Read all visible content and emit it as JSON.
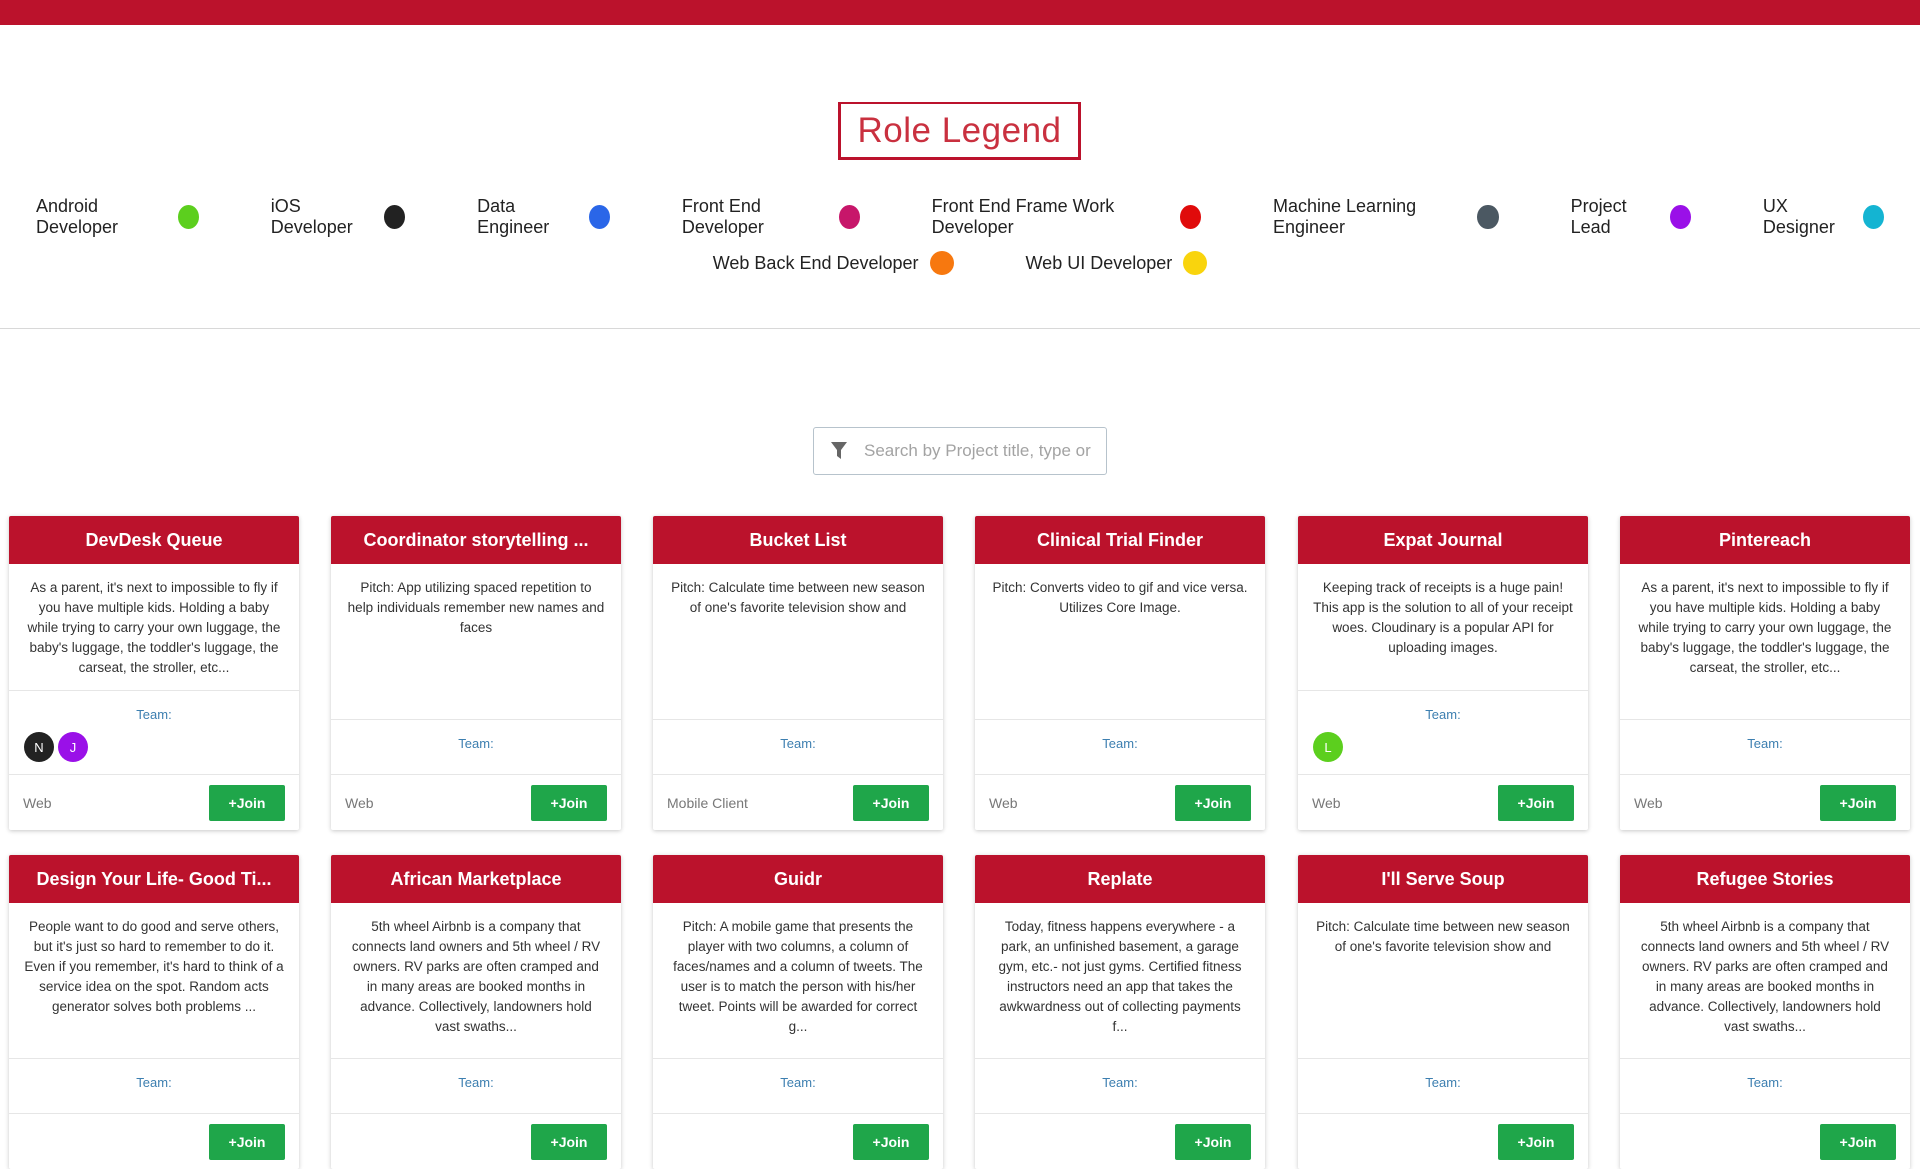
{
  "legend": {
    "title": "Role Legend",
    "roles": [
      {
        "name": "Android Developer",
        "color": "#5ccf1e"
      },
      {
        "name": "iOS Developer",
        "color": "#222222"
      },
      {
        "name": "Data Engineer",
        "color": "#2a66e8"
      },
      {
        "name": "Front End Developer",
        "color": "#c7166a"
      },
      {
        "name": "Front End Frame Work Developer",
        "color": "#e00b0b"
      },
      {
        "name": "Machine Learning Engineer",
        "color": "#4b5862"
      },
      {
        "name": "Project Lead",
        "color": "#9a10e8"
      },
      {
        "name": "UX Designer",
        "color": "#14b4d2"
      },
      {
        "name": "Web Back End Developer",
        "color": "#f7780f"
      },
      {
        "name": "Web UI Developer",
        "color": "#f9d40d"
      }
    ]
  },
  "search": {
    "placeholder": "Search by Project title, type or team member"
  },
  "projects": [
    {
      "title": "DevDesk Queue",
      "description": "As a parent, it's next to impossible to fly if you have multiple kids. Holding a baby while trying to carry your own luggage, the baby's luggage, the toddler's luggage, the carseat, the stroller, etc...",
      "team_label": "Team:",
      "members": [
        {
          "initial": "N",
          "color": "#222222"
        },
        {
          "initial": "J",
          "color": "#9a10e8"
        }
      ],
      "type": "Web",
      "join": "+Join"
    },
    {
      "title": "Coordinator storytelling ...",
      "description": "Pitch: App utilizing spaced repetition to help individuals remember new names and faces",
      "team_label": "Team:",
      "members": [],
      "type": "Web",
      "join": "+Join"
    },
    {
      "title": "Bucket List",
      "description": "Pitch: Calculate time between new season of one's favorite television show and",
      "team_label": "Team:",
      "members": [],
      "type": "Mobile Client",
      "join": "+Join"
    },
    {
      "title": "Clinical Trial Finder",
      "description": "Pitch: Converts video to gif and vice versa. Utilizes Core Image.",
      "team_label": "Team:",
      "members": [],
      "type": "Web",
      "join": "+Join"
    },
    {
      "title": "Expat Journal",
      "description": "Keeping track of receipts is a huge pain! This app is the solution to all of your receipt woes. Cloudinary is a popular API for uploading images.",
      "team_label": "Team:",
      "members": [
        {
          "initial": "L",
          "color": "#5ccf1e"
        }
      ],
      "type": "Web",
      "join": "+Join"
    },
    {
      "title": "Pintereach",
      "description": "As a parent, it's next to impossible to fly if you have multiple kids. Holding a baby while trying to carry your own luggage, the baby's luggage, the toddler's luggage, the carseat, the stroller, etc...",
      "team_label": "Team:",
      "members": [],
      "type": "Web",
      "join": "+Join"
    },
    {
      "title": "Design Your Life- Good Ti...",
      "description": "People want to do good and serve others, but it's just so hard to remember to do it. Even if you remember, it's hard to think of a service idea on the spot. Random acts generator solves both problems ...",
      "team_label": "Team:",
      "members": [],
      "type": "",
      "join": "+Join"
    },
    {
      "title": "African Marketplace",
      "description": "5th wheel Airbnb is a company that connects land owners and 5th wheel / RV owners. RV parks are often cramped and in many areas are booked months in advance. Collectively, landowners hold vast swaths...",
      "team_label": "Team:",
      "members": [],
      "type": "",
      "join": "+Join"
    },
    {
      "title": "Guidr",
      "description": "Pitch: A mobile game that presents the player with two columns, a column of faces/names and a column of tweets. The user is to match the person with his/her tweet. Points will be awarded for correct g...",
      "team_label": "Team:",
      "members": [],
      "type": "",
      "join": "+Join"
    },
    {
      "title": "Replate",
      "description": "Today, fitness happens everywhere - a park, an unfinished basement, a garage gym, etc.- not just gyms. Certified fitness instructors need an app that takes the awkwardness out of collecting payments f...",
      "team_label": "Team:",
      "members": [],
      "type": "",
      "join": "+Join"
    },
    {
      "title": "I'll Serve Soup",
      "description": "Pitch: Calculate time between new season of one's favorite television show and",
      "team_label": "Team:",
      "members": [],
      "type": "",
      "join": "+Join"
    },
    {
      "title": "Refugee Stories",
      "description": "5th wheel Airbnb is a company that connects land owners and 5th wheel / RV owners. RV parks are often cramped and in many areas are booked months in advance. Collectively, landowners hold vast swaths...",
      "team_label": "Team:",
      "members": [],
      "type": "",
      "join": "+Join"
    }
  ]
}
